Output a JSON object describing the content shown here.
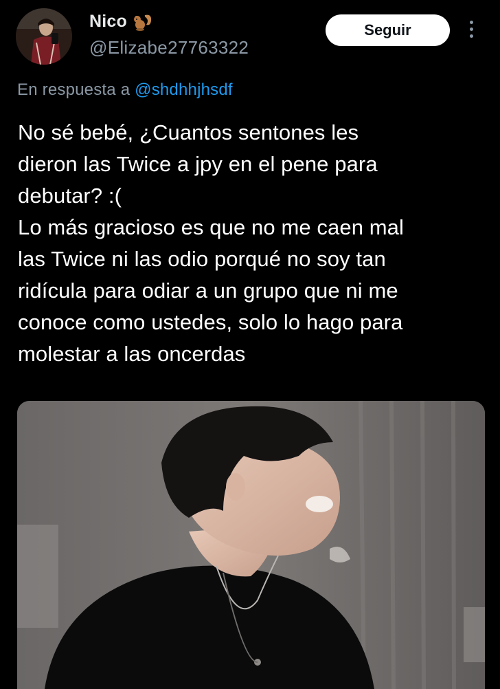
{
  "author": {
    "display_name": "Nico",
    "name_emoji_icon": "squirrel-icon",
    "handle": "@Elizabe27763322",
    "avatar_icon": "profile-photo"
  },
  "actions": {
    "follow_label": "Seguir",
    "more_icon": "more-vertical-icon"
  },
  "reply": {
    "prefix": "En respuesta a",
    "mention": "@shdhhjhsdf"
  },
  "tweet": {
    "text": "No sé bebé, ¿Cuantos sentones les\ndieron las Twice a jpy en el pene para\ndebutar? :(\nLo más gracioso es que no me caen mal\nlas Twice ni las odio porqué no soy tan\nridícula para odiar a un grupo que ni me\nconoce como ustedes, solo lo hago para\nmolestar a las oncerdas"
  },
  "media": {
    "kind": "photo-of-laughing-person"
  },
  "colors": {
    "background": "#000000",
    "text_primary": "#e7e9ea",
    "text_secondary": "#8b98a5",
    "link": "#1d9bf0",
    "button_bg": "#ffffff",
    "button_text": "#0f1419"
  }
}
